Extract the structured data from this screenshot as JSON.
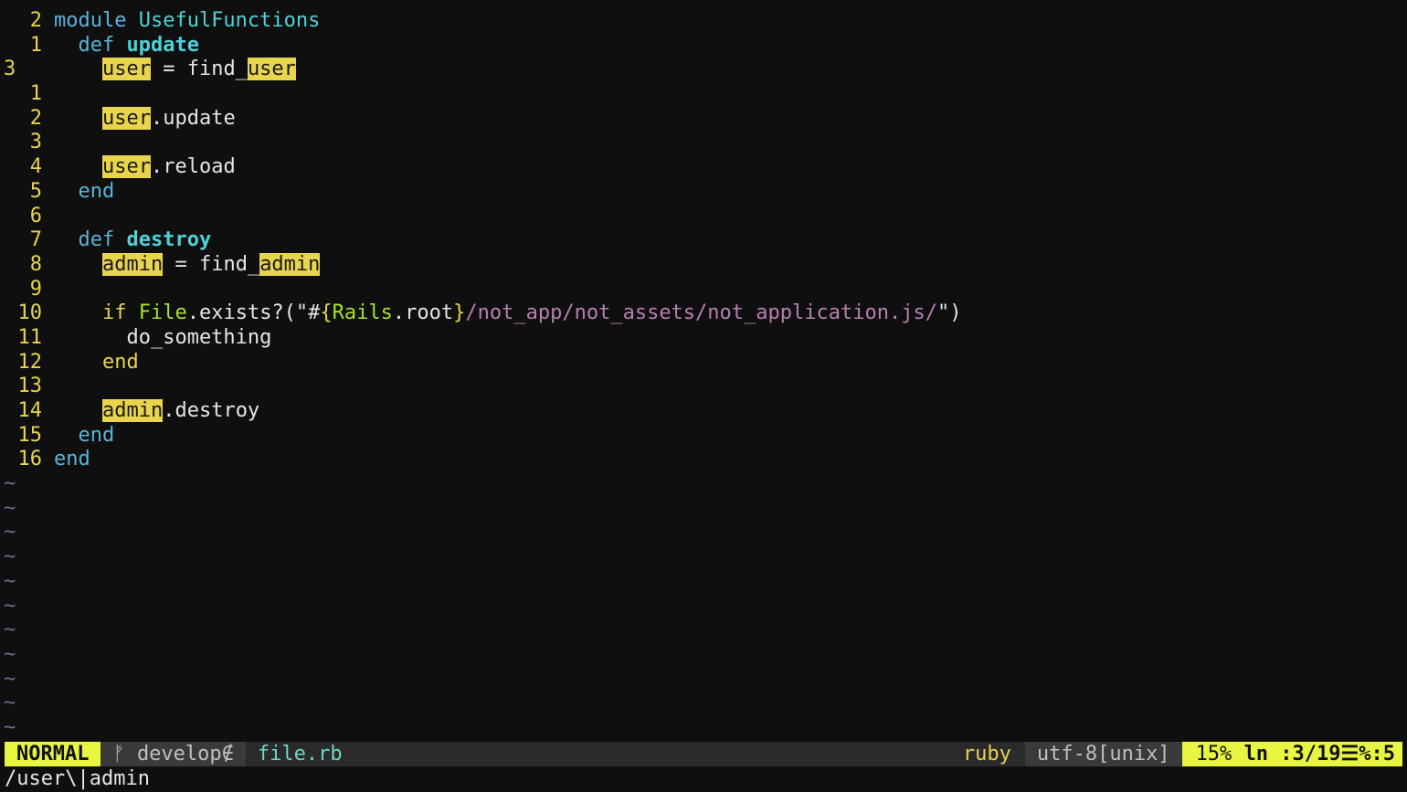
{
  "editor": {
    "lines": [
      {
        "num": "2",
        "current": false,
        "segments": [
          {
            "t": "module ",
            "c": "kw"
          },
          {
            "t": "UsefulFunctions",
            "c": "mod"
          }
        ]
      },
      {
        "num": "1",
        "current": false,
        "segments": [
          {
            "t": "  def ",
            "c": "kw"
          },
          {
            "t": "update",
            "c": "fn"
          }
        ]
      },
      {
        "num": "3",
        "current": true,
        "segments": [
          {
            "t": "    ",
            "c": "plain"
          },
          {
            "t": "user",
            "c": "hl"
          },
          {
            "t": " = find_",
            "c": "plain"
          },
          {
            "t": "user",
            "c": "hl"
          }
        ]
      },
      {
        "num": "1",
        "current": false,
        "segments": []
      },
      {
        "num": "2",
        "current": false,
        "segments": [
          {
            "t": "    ",
            "c": "plain"
          },
          {
            "t": "user",
            "c": "hl"
          },
          {
            "t": ".update",
            "c": "plain"
          }
        ]
      },
      {
        "num": "3",
        "current": false,
        "segments": []
      },
      {
        "num": "4",
        "current": false,
        "segments": [
          {
            "t": "    ",
            "c": "plain"
          },
          {
            "t": "user",
            "c": "hl"
          },
          {
            "t": ".reload",
            "c": "plain"
          }
        ]
      },
      {
        "num": "5",
        "current": false,
        "segments": [
          {
            "t": "  end",
            "c": "kw"
          }
        ]
      },
      {
        "num": "6",
        "current": false,
        "segments": []
      },
      {
        "num": "7",
        "current": false,
        "segments": [
          {
            "t": "  def ",
            "c": "kw"
          },
          {
            "t": "destroy",
            "c": "fn"
          }
        ]
      },
      {
        "num": "8",
        "current": false,
        "segments": [
          {
            "t": "    ",
            "c": "plain"
          },
          {
            "t": "admin",
            "c": "hl"
          },
          {
            "t": " = find_",
            "c": "plain"
          },
          {
            "t": "admin",
            "c": "hl"
          }
        ]
      },
      {
        "num": "9",
        "current": false,
        "segments": []
      },
      {
        "num": "10",
        "current": false,
        "segments": [
          {
            "t": "    ",
            "c": "plain"
          },
          {
            "t": "if ",
            "c": "kw-end"
          },
          {
            "t": "File",
            "c": "const"
          },
          {
            "t": ".exists?(\"#",
            "c": "plain"
          },
          {
            "t": "{",
            "c": "interp"
          },
          {
            "t": "Rails",
            "c": "const"
          },
          {
            "t": ".root",
            "c": "plain"
          },
          {
            "t": "}",
            "c": "interp"
          },
          {
            "t": "/not_app/not_assets/not_application.js/",
            "c": "str"
          },
          {
            "t": "\")",
            "c": "plain"
          }
        ]
      },
      {
        "num": "11",
        "current": false,
        "segments": [
          {
            "t": "      do_something",
            "c": "plain"
          }
        ]
      },
      {
        "num": "12",
        "current": false,
        "segments": [
          {
            "t": "    end",
            "c": "kw-end"
          }
        ]
      },
      {
        "num": "13",
        "current": false,
        "segments": []
      },
      {
        "num": "14",
        "current": false,
        "segments": [
          {
            "t": "    ",
            "c": "plain"
          },
          {
            "t": "admin",
            "c": "hl"
          },
          {
            "t": ".destroy",
            "c": "plain"
          }
        ]
      },
      {
        "num": "15",
        "current": false,
        "segments": [
          {
            "t": "  end",
            "c": "kw"
          }
        ]
      },
      {
        "num": "16",
        "current": false,
        "segments": [
          {
            "t": "end",
            "c": "kw"
          }
        ]
      }
    ],
    "empty_marker": "~",
    "empty_lines": 11
  },
  "statusline": {
    "mode": "NORMAL",
    "branch_icon": "ᚠ",
    "branch": "develop",
    "branch_dirty": "∉",
    "filename": "file.rb",
    "filetype": "ruby",
    "encoding": "utf-8[unix]",
    "percent": "15%",
    "position_prefix": "ln :",
    "position": "3/19",
    "column_sep": "☰%:",
    "column": "5"
  },
  "cmdline": {
    "text": "/user\\|admin"
  },
  "colors": {
    "background": "#0f0f0f",
    "keyword": "#5ab4d9",
    "function": "#4fd1d9",
    "highlight": "#e8d44d",
    "mode_bg": "#e8f542",
    "string": "#b87fb1"
  }
}
